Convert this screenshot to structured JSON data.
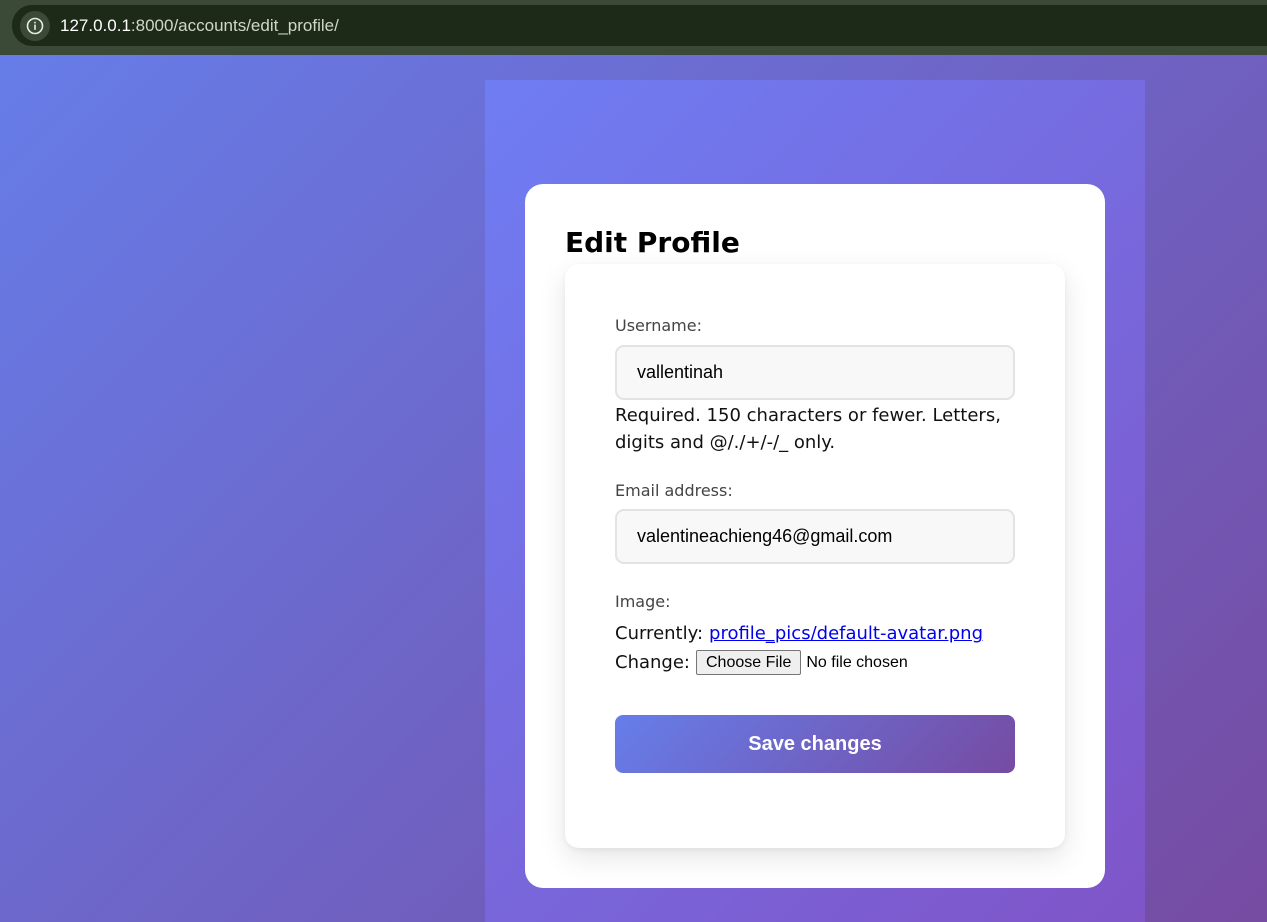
{
  "browser": {
    "url_host": "127.0.0.1",
    "url_rest": ":8000/accounts/edit_profile/",
    "info_icon": "info-icon"
  },
  "page": {
    "title": "Edit Profile"
  },
  "form": {
    "username": {
      "label": "Username:",
      "value": "vallentinah",
      "help": "Required. 150 characters or fewer. Letters, digits and @/./+/-/_ only."
    },
    "email": {
      "label": "Email address:",
      "value": "valentineachieng46@gmail.com"
    },
    "image": {
      "label": "Image:",
      "currently_label": "Currently:",
      "current_file": "profile_pics/default-avatar.png",
      "change_label": "Change:",
      "choose_button": "Choose File",
      "no_file": "No file chosen"
    },
    "submit_label": "Save changes"
  },
  "colors": {
    "gradient_start": "#667eea",
    "gradient_end": "#764ba2",
    "link": "#0000ee"
  }
}
